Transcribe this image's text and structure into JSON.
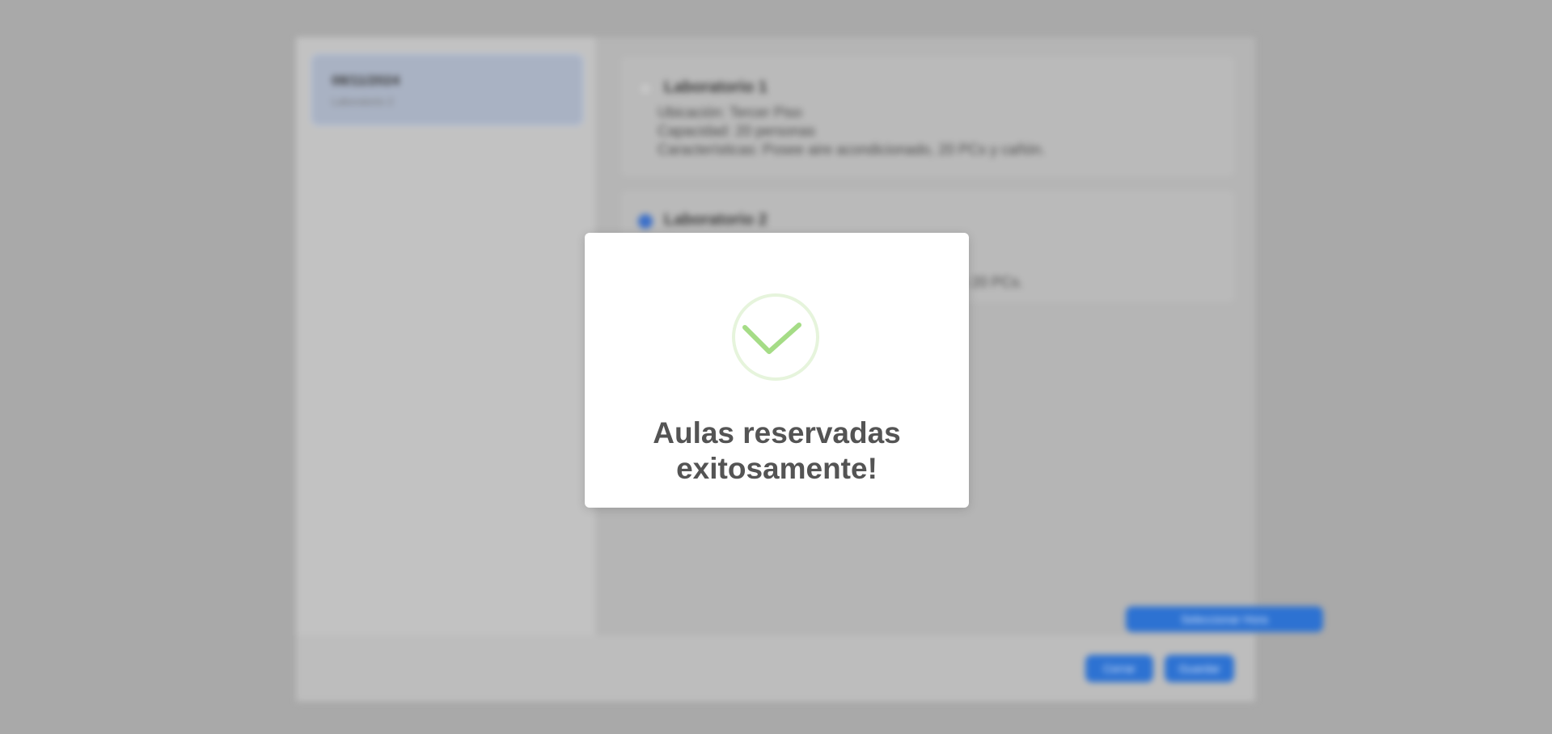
{
  "background": {
    "sidebar": {
      "item_title": "08/11/2024",
      "item_subtitle": "Laboratorio 2"
    },
    "labs": [
      {
        "title": "Laboratorio 1",
        "selected": false,
        "ubicacion": "Ubicación: Tercer Piso",
        "capacidad": "Capacidad: 20 personas",
        "caracteristicas": "Características: Posee aire acondicionado, 20 PCs y cañón."
      },
      {
        "title": "Laboratorio 2",
        "selected": true,
        "caracteristicas_tail": "y 20 PCs."
      }
    ],
    "schedule_button": "Seleccionar Hora",
    "footer_button_1": "Cerrar",
    "footer_button_2": "Guardar"
  },
  "modal": {
    "icon": "success-check-icon",
    "title_line1": "Aulas reservadas",
    "title_line2": "exitosamente!"
  },
  "colors": {
    "overlay": "#a9a9a9",
    "success_green": "#a5dc86",
    "success_ring": "#e6f4dc",
    "accent_blue": "#2d72d2"
  }
}
